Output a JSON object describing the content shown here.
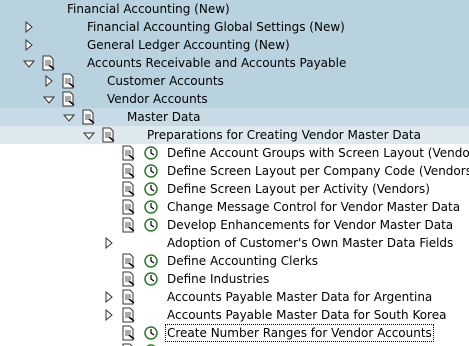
{
  "tree": {
    "root": {
      "label": "Financial Accounting (New)"
    },
    "global_settings": {
      "label": "Financial Accounting Global Settings (New)"
    },
    "gl_accounting": {
      "label": "General Ledger Accounting (New)"
    },
    "ar_ap": {
      "label": "Accounts Receivable and Accounts Payable"
    },
    "customer_accounts": {
      "label": "Customer Accounts"
    },
    "vendor_accounts": {
      "label": "Vendor Accounts"
    },
    "master_data": {
      "label": "Master Data"
    },
    "preparations": {
      "label": "Preparations for Creating Vendor Master Data"
    },
    "items": [
      {
        "label": "Define Account Groups with Screen Layout (Vendors)"
      },
      {
        "label": "Define Screen Layout per Company Code (Vendors)"
      },
      {
        "label": "Define Screen Layout per Activity (Vendors)"
      },
      {
        "label": "Change Message Control for Vendor Master Data"
      },
      {
        "label": "Develop Enhancements for Vendor Master Data"
      },
      {
        "label": "Adoption of Customer's Own Master Data Fields"
      },
      {
        "label": "Define Accounting Clerks"
      },
      {
        "label": "Define Industries"
      },
      {
        "label": "Accounts Payable Master Data for Argentina"
      },
      {
        "label": "Accounts Payable Master Data for South Korea"
      },
      {
        "label": "Create Number Ranges for Vendor Accounts"
      }
    ]
  },
  "colors": {
    "header_band": "#b9d2e0",
    "selected_band": "#dde9ef",
    "clock_green": "#2a7a2a"
  }
}
